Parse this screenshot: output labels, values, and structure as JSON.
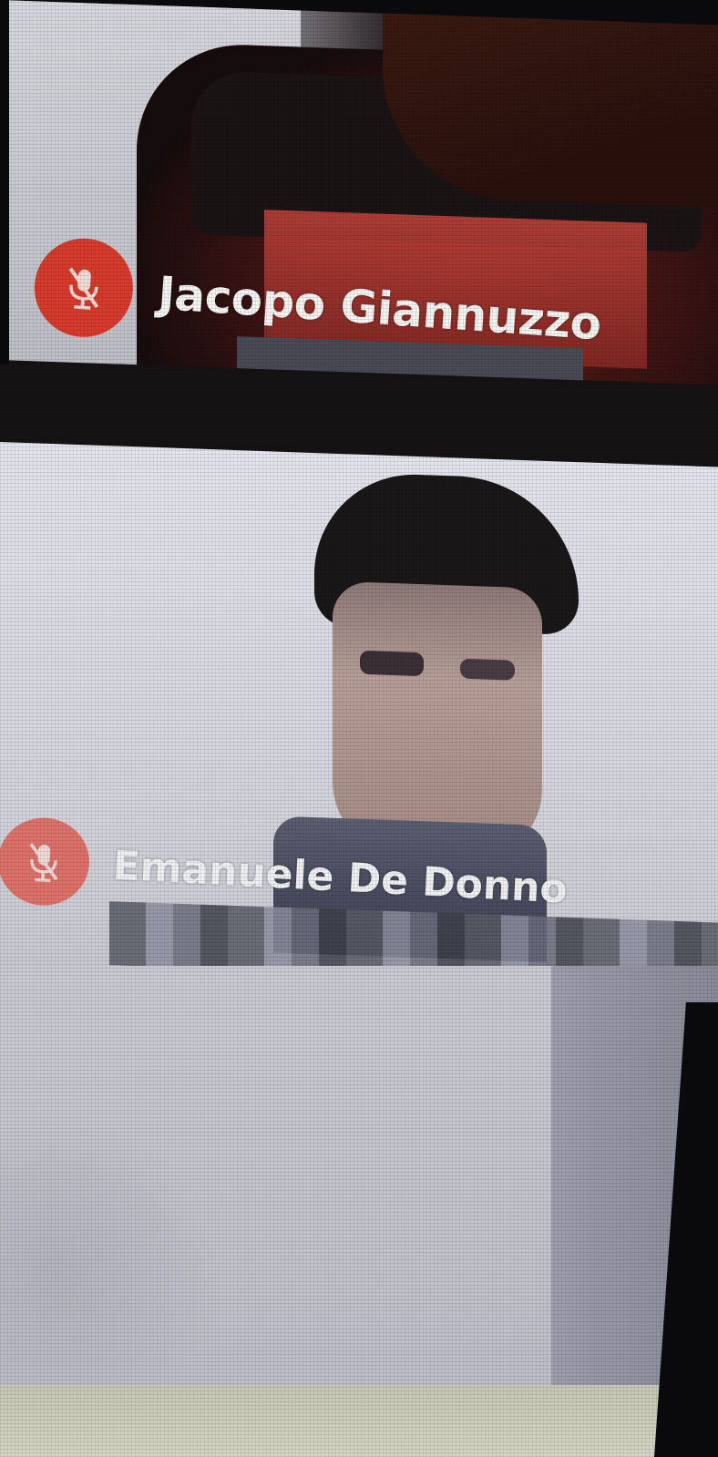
{
  "participants": [
    {
      "name": "Jacopo Giannuzzo",
      "mic_icon": "mic-off-icon",
      "muted": true
    },
    {
      "name": "Emanuele De Donno",
      "mic_icon": "mic-off-icon",
      "muted": true
    }
  ],
  "colors": {
    "muted_badge": "#d83a2c",
    "name_text": "#f4f4f2"
  }
}
